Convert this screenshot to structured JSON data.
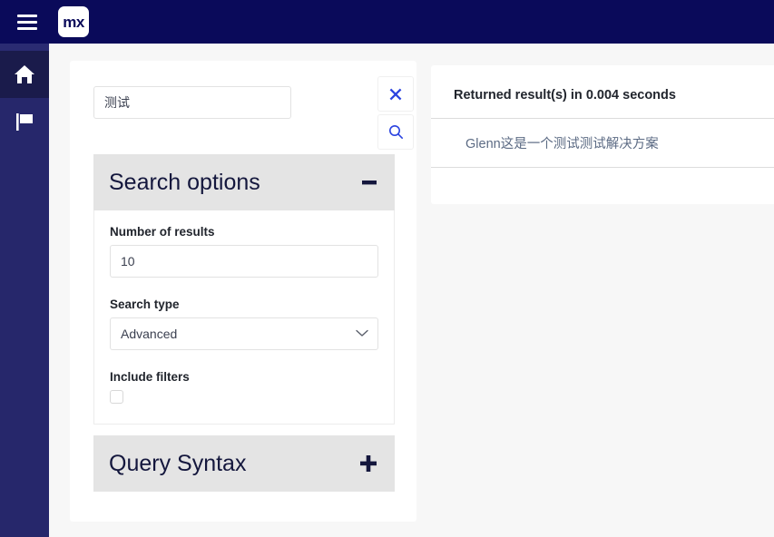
{
  "header": {
    "menu_icon": "hamburger-icon",
    "logo_text": "mx"
  },
  "sidebar": {
    "items": [
      {
        "icon": "home-icon",
        "name": "home",
        "active": true
      },
      {
        "icon": "flag-icon",
        "name": "flag",
        "active": false
      }
    ]
  },
  "search": {
    "query_value": "测试",
    "query_placeholder": "",
    "clear_icon": "close-icon",
    "submit_icon": "search-icon"
  },
  "search_options": {
    "title": "Search options",
    "toggle_icon": "minus-icon",
    "expanded": true,
    "number_of_results": {
      "label": "Number of results",
      "value": "10"
    },
    "search_type": {
      "label": "Search type",
      "value": "Advanced",
      "options": [
        "Advanced"
      ],
      "chevron_icon": "chevron-down-icon"
    },
    "include_filters": {
      "label": "Include filters",
      "checked": false
    }
  },
  "query_syntax": {
    "title": "Query Syntax",
    "toggle_icon": "plus-icon",
    "expanded": false
  },
  "results": {
    "summary": "Returned result(s) in 0.004 seconds",
    "items": [
      {
        "title": "Glenn这是一个测试测试解决方案"
      }
    ]
  },
  "colors": {
    "brand_navy": "#0a0a5a",
    "sidebar": "#26276b",
    "sidebar_active": "#1a1b4b",
    "accent_blue": "#2b43e0",
    "panel_header": "#e4e4e4",
    "page_bg": "#f7f7f7",
    "link": "#5c6b84"
  }
}
